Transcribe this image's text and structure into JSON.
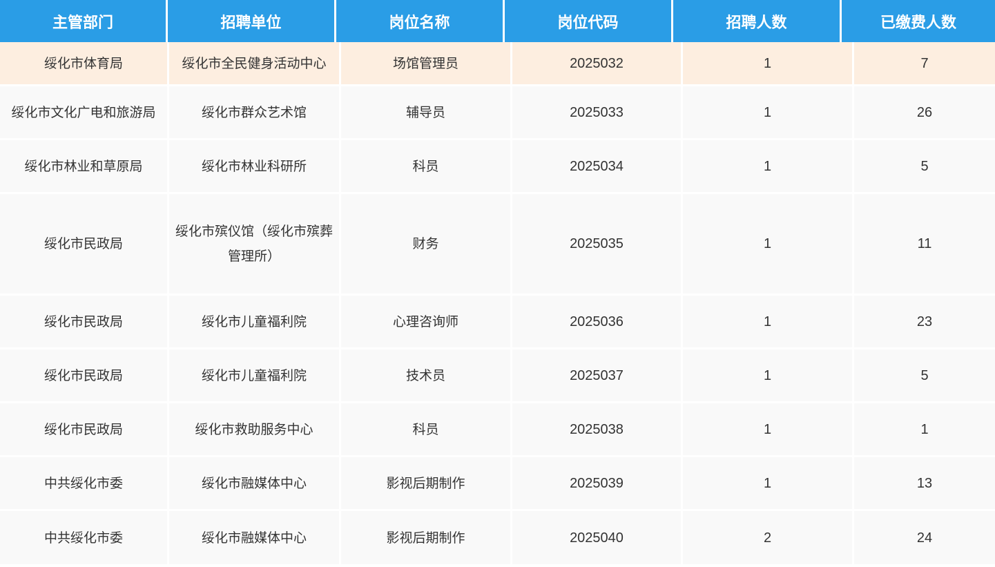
{
  "table": {
    "headers": [
      "主管部门",
      "招聘单位",
      "岗位名称",
      "岗位代码",
      "招聘人数",
      "已缴费人数"
    ],
    "rows": [
      {
        "dept": "绥化市体育局",
        "unit": "绥化市全民健身活动中心",
        "position": "场馆管理员",
        "code": "2025032",
        "quota": "1",
        "paid": "7"
      },
      {
        "dept": "绥化市文化广电和旅游局",
        "unit": "绥化市群众艺术馆",
        "position": "辅导员",
        "code": "2025033",
        "quota": "1",
        "paid": "26"
      },
      {
        "dept": "绥化市林业和草原局",
        "unit": "绥化市林业科研所",
        "position": "科员",
        "code": "2025034",
        "quota": "1",
        "paid": "5"
      },
      {
        "dept": "绥化市民政局",
        "unit": "绥化市殡仪馆（绥化市殡葬管理所）",
        "position": "财务",
        "code": "2025035",
        "quota": "1",
        "paid": "11"
      },
      {
        "dept": "绥化市民政局",
        "unit": "绥化市儿童福利院",
        "position": "心理咨询师",
        "code": "2025036",
        "quota": "1",
        "paid": "23"
      },
      {
        "dept": "绥化市民政局",
        "unit": "绥化市儿童福利院",
        "position": "技术员",
        "code": "2025037",
        "quota": "1",
        "paid": "5"
      },
      {
        "dept": "绥化市民政局",
        "unit": "绥化市救助服务中心",
        "position": "科员",
        "code": "2025038",
        "quota": "1",
        "paid": "1"
      },
      {
        "dept": "中共绥化市委",
        "unit": "绥化市融媒体中心",
        "position": "影视后期制作",
        "code": "2025039",
        "quota": "1",
        "paid": "13"
      },
      {
        "dept": "中共绥化市委",
        "unit": "绥化市融媒体中心",
        "position": "影视后期制作",
        "code": "2025040",
        "quota": "2",
        "paid": "24"
      }
    ]
  },
  "colors": {
    "header_bg": "#2a9de6",
    "header_text": "#ffffff",
    "row_bg": "#f9f9f9",
    "highlight_row_bg": "#fdeee0",
    "cell_text": "#333333"
  }
}
